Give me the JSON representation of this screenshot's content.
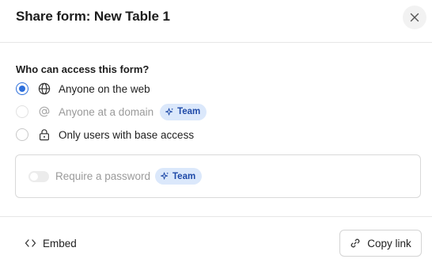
{
  "dialog": {
    "title": "Share form: New Table 1"
  },
  "access": {
    "heading": "Who can access this form?",
    "options": [
      {
        "label": "Anyone on the web",
        "icon": "globe-icon",
        "selected": true,
        "disabled": false
      },
      {
        "label": "Anyone at a domain",
        "icon": "at-sign-icon",
        "selected": false,
        "disabled": true,
        "badge": "Team"
      },
      {
        "label": "Only users with base access",
        "icon": "lock-icon",
        "selected": false,
        "disabled": false
      }
    ]
  },
  "password": {
    "label": "Require a password",
    "enabled": false,
    "badge": "Team"
  },
  "footer": {
    "embed_label": "Embed",
    "copy_link_label": "Copy link"
  },
  "colors": {
    "accent": "#2d6fdb",
    "badge_bg": "#dbe8fb",
    "badge_text": "#1f4aa8"
  }
}
